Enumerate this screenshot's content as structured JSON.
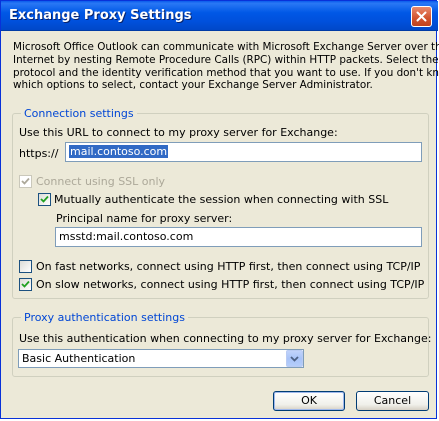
{
  "window": {
    "title": "Exchange Proxy Settings"
  },
  "intro": {
    "lines": [
      "Microsoft Office Outlook can communicate with Microsoft Exchange Server over the",
      "Internet by nesting Remote Procedure Calls (RPC) within HTTP packets.  Select the",
      "protocol and the identity verification method that you want to use.  If you don't know",
      "which options to select, contact your Exchange Server Administrator."
    ]
  },
  "connection": {
    "legend": "Connection settings",
    "url_label": "Use this URL to connect to my proxy server for Exchange:",
    "url_prefix": "https://",
    "url_value": "mail.contoso.com",
    "ssl_label": "Connect using SSL only",
    "ssl_checked": true,
    "ssl_disabled": true,
    "mutual_label": "Mutually authenticate the session when connecting with SSL",
    "mutual_checked": true,
    "principal_label": "Principal name for proxy server:",
    "principal_value": "msstd:mail.contoso.com",
    "fast_label": "On fast networks, connect using HTTP first, then connect using TCP/IP",
    "fast_checked": false,
    "slow_label": "On slow networks, connect using HTTP first, then connect using TCP/IP",
    "slow_checked": true
  },
  "auth": {
    "legend": "Proxy authentication settings",
    "label": "Use this authentication when connecting to my proxy server for Exchange:",
    "selected": "Basic Authentication"
  },
  "buttons": {
    "ok": "OK",
    "cancel": "Cancel"
  },
  "icons": {
    "close": "close-icon",
    "check": "check-icon",
    "dropdown": "chevron-down-icon"
  }
}
